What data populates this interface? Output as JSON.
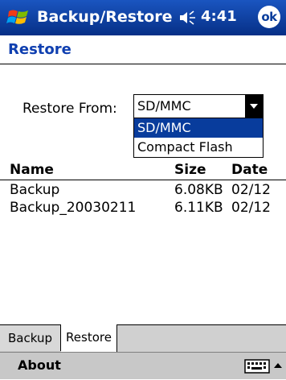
{
  "titlebar": {
    "app_title": "Backup/Restore",
    "time": "4:41",
    "ok_label": "ok"
  },
  "page": {
    "title": "Restore"
  },
  "restore_from": {
    "label": "Restore From:",
    "selected_value": "SD/MMC",
    "options": [
      "SD/MMC",
      "Compact Flash"
    ],
    "highlighted_option": "SD/MMC"
  },
  "list": {
    "columns": [
      "Name",
      "Size",
      "Date"
    ],
    "rows": [
      {
        "name": "Backup",
        "size": "6.08KB",
        "date": "02/12"
      },
      {
        "name": "Backup_20030211",
        "size": "6.11KB",
        "date": "02/12"
      }
    ]
  },
  "tabs": [
    {
      "label": "Backup",
      "active": false
    },
    {
      "label": "Restore",
      "active": true
    }
  ],
  "command_bar": {
    "menu_label": "About"
  },
  "colors": {
    "titlebar": "#083c9c",
    "page_title": "#0f3fb0",
    "selection": "#083c9c",
    "command_bar": "#c8c8c8"
  },
  "icons": {
    "start": "windows-flag-icon",
    "volume": "speaker-icon",
    "input": "keyboard-icon",
    "input_arrow": "chevron-up-icon"
  }
}
